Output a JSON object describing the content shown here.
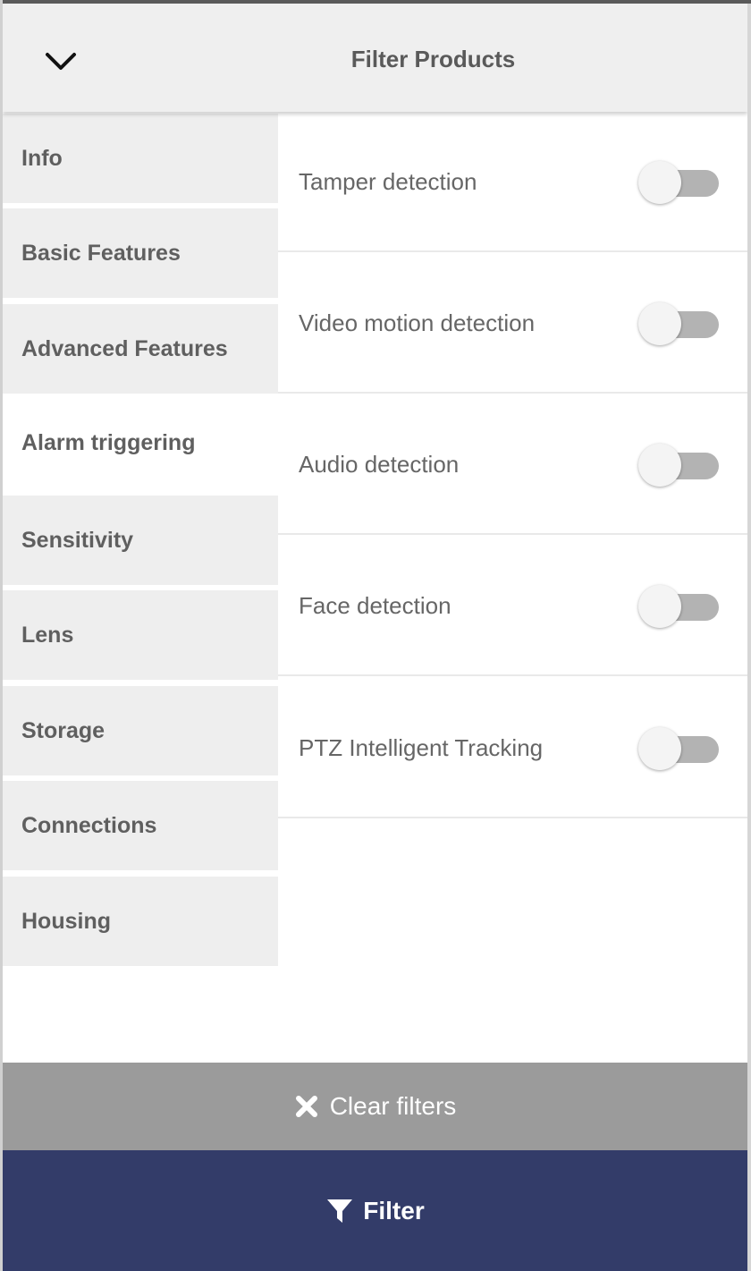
{
  "header": {
    "title": "Filter Products",
    "collapse_icon": "chevron-down-icon"
  },
  "sidebar": {
    "items": [
      {
        "label": "Info",
        "active": false
      },
      {
        "label": "Basic Features",
        "active": false
      },
      {
        "label": "Advanced Features",
        "active": false
      },
      {
        "label": "Alarm triggering",
        "active": true
      },
      {
        "label": "Sensitivity",
        "active": false
      },
      {
        "label": "Lens",
        "active": false
      },
      {
        "label": "Storage",
        "active": false
      },
      {
        "label": "Connections",
        "active": false
      },
      {
        "label": "Housing",
        "active": false
      }
    ]
  },
  "options": [
    {
      "label": "Tamper detection",
      "enabled": false
    },
    {
      "label": "Video motion detection",
      "enabled": false
    },
    {
      "label": "Audio detection",
      "enabled": false
    },
    {
      "label": "Face detection",
      "enabled": false
    },
    {
      "label": "PTZ Intelligent Tracking",
      "enabled": false
    }
  ],
  "actions": {
    "clear_label": "Clear filters",
    "clear_icon": "close-icon",
    "filter_label": "Filter",
    "filter_icon": "funnel-icon"
  },
  "colors": {
    "header_bg": "#efefef",
    "sidebar_bg": "#eeeeee",
    "clear_bg": "#9b9b9b",
    "filter_bg": "#333c69",
    "toggle_off_track": "#b3b3b3"
  }
}
